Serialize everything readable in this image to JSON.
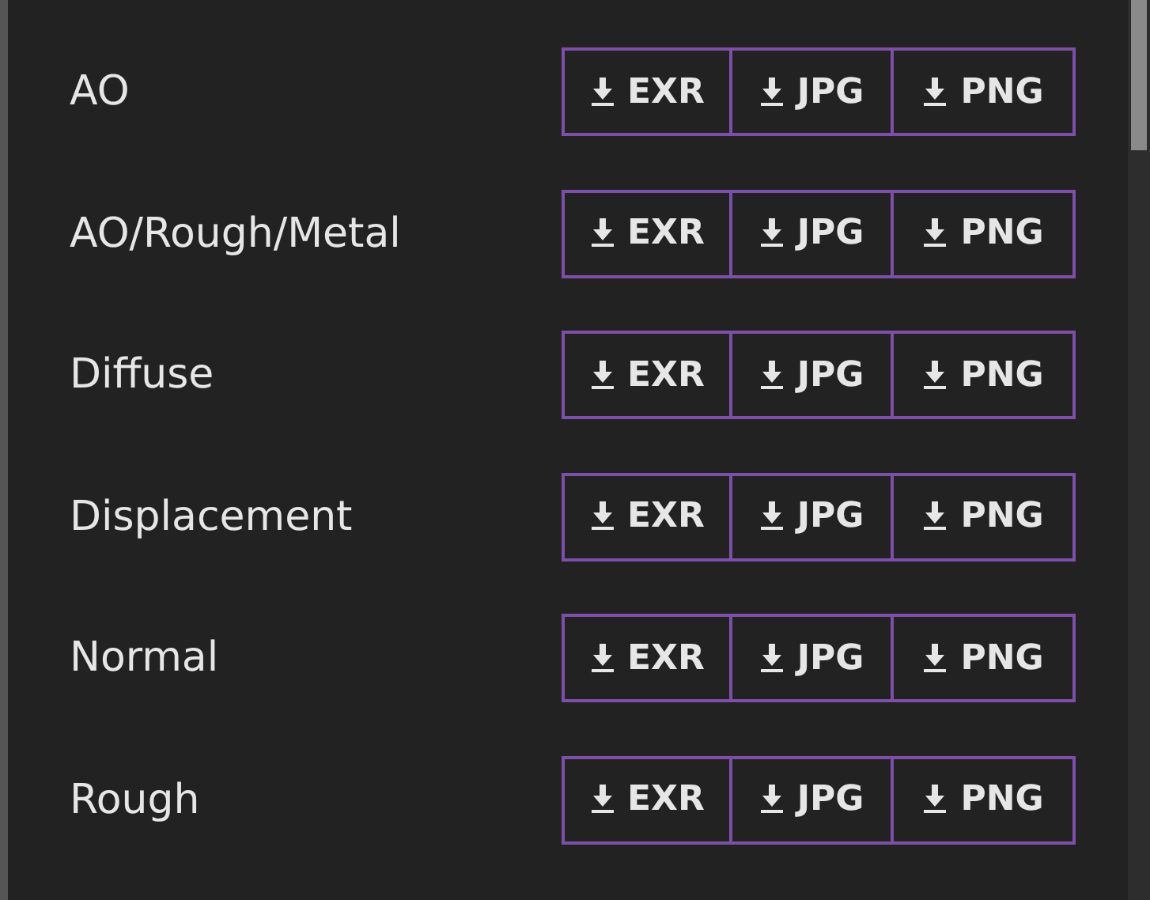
{
  "maps": [
    {
      "label": "AO",
      "formats": [
        "EXR",
        "JPG",
        "PNG"
      ]
    },
    {
      "label": "AO/Rough/Metal",
      "formats": [
        "EXR",
        "JPG",
        "PNG"
      ]
    },
    {
      "label": "Diffuse",
      "formats": [
        "EXR",
        "JPG",
        "PNG"
      ]
    },
    {
      "label": "Displacement",
      "formats": [
        "EXR",
        "JPG",
        "PNG"
      ]
    },
    {
      "label": "Normal",
      "formats": [
        "EXR",
        "JPG",
        "PNG"
      ]
    },
    {
      "label": "Rough",
      "formats": [
        "EXR",
        "JPG",
        "PNG"
      ]
    }
  ]
}
